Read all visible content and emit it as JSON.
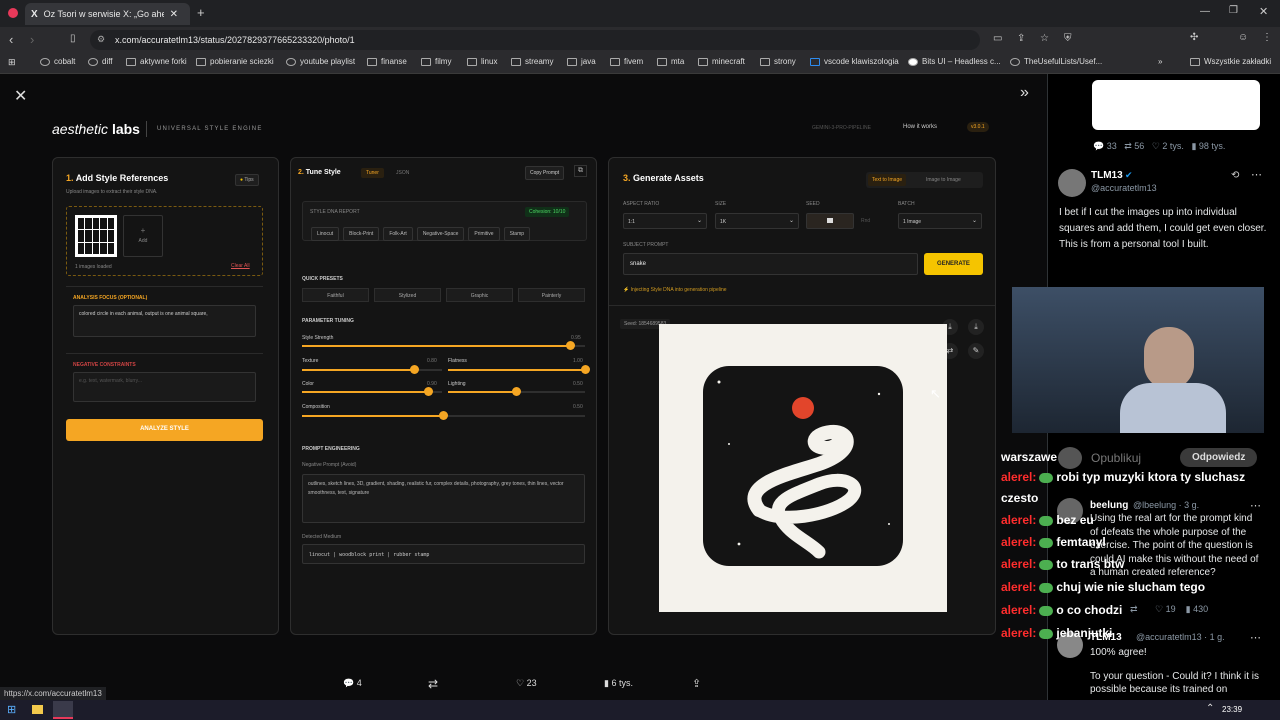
{
  "browser": {
    "tab_title": "Oz Tsori w serwisie X: „Go ahead…",
    "url": "x.com/accuratetlm13/status/2027829377665233320/photo/1",
    "bookmarks": [
      "cobalt",
      "diff",
      "aktywne forki",
      "pobieranie sciezki",
      "youtube playlist",
      "finanse",
      "filmy",
      "linux",
      "streamy",
      "java",
      "fivem",
      "mta",
      "minecraft",
      "strony",
      "vscode klawiszologia",
      "Bits UI – Headless c...",
      "TheUsefulLists/Usef..."
    ],
    "other_bookmarks": "Wszystkie zakładki",
    "status_url": "https://x.com/accuratetlm13"
  },
  "app": {
    "logo_italic": "aesthetic",
    "logo_bold": "labs",
    "subtitle": "UNIVERSAL STYLE ENGINE",
    "pipeline": "GEMINI-3-PRO-PIPELINE",
    "how_it_works": "How it works",
    "version": "v3.0.1",
    "panel1": {
      "step": "1.",
      "title": "Add Style References",
      "tips": "Tips",
      "desc": "Upload images to extract their style DNA.",
      "add": "Add",
      "loaded": "1 images loaded",
      "clear_all": "Clear All",
      "focus_label": "ANALYSIS FOCUS (OPTIONAL)",
      "focus_value": "colored circle in each animal, output is one animal square,",
      "neg_label": "NEGATIVE CONSTRAINTS",
      "neg_placeholder": "e.g. text, watermark, blurry...",
      "analyze_btn": "ANALYZE STYLE"
    },
    "panel2": {
      "step": "2.",
      "title": "Tune Style",
      "tab_tuner": "Tuner",
      "tab_json": "JSON",
      "copy_prompt": "Copy Prompt",
      "dna_label": "STYLE DNA REPORT",
      "cohesion": "Cohesion: 10/10",
      "tags": [
        "Linocut",
        "Block-Print",
        "Folk-Art",
        "Negative-Space",
        "Primitive",
        "Stamp"
      ],
      "presets_label": "QUICK PRESETS",
      "presets": [
        "Faithful",
        "Stylized",
        "Graphic",
        "Painterly"
      ],
      "tuning_label": "PARAMETER TUNING",
      "sliders": [
        {
          "label": "Style Strength",
          "value": "0.95",
          "level": 0.95
        },
        {
          "label": "Texture",
          "value": "0.80",
          "level": 0.8
        },
        {
          "label": "Flatness",
          "value": "1.00",
          "level": 1.0
        },
        {
          "label": "Color",
          "value": "0.90",
          "level": 0.9
        },
        {
          "label": "Lighting",
          "value": "0.50",
          "level": 0.5
        },
        {
          "label": "Composition",
          "value": "0.50",
          "level": 0.5
        }
      ],
      "prompt_eng_label": "PROMPT ENGINEERING",
      "neg_prompt_label": "Negative Prompt (Avoid)",
      "neg_prompt_value": "outlines, sketch lines, 3D, gradient, shading, realistic fur, complex details, photography, grey tones, thin lines, vector smoothness, text, signature",
      "medium_label": "Detected Medium",
      "medium_value": "linocut | woodblock print | rubber stamp"
    },
    "panel3": {
      "step": "3.",
      "title": "Generate Assets",
      "tab_t2i": "Text to Image",
      "tab_i2i": "Image to Image",
      "aspect_label": "ASPECT RATIO",
      "aspect_value": "1:1",
      "size_label": "SIZE",
      "size_value": "1K",
      "seed_label": "SEED",
      "seed_rnd": "Rnd",
      "batch_label": "BATCH",
      "batch_value": "1 Image",
      "subject_label": "SUBJECT PROMPT",
      "subject_value": "snake",
      "generate_btn": "GENERATE",
      "inject_note": "Injecting Style DNA into generation pipeline",
      "seed_badge": "Seed: 1854689583"
    }
  },
  "tweet_actions": {
    "replies": "4",
    "likes": "23",
    "views": "6 tys."
  },
  "feed": {
    "post_stats": {
      "replies": "33",
      "reposts": "56",
      "likes": "2 tys.",
      "views": "98 tys."
    },
    "reply1": {
      "name": "TLM13",
      "handle": "@accuratetlm13",
      "text": "I bet if I cut the images up into individual squares and add them, I could get even closer.  This is from a personal tool I built."
    },
    "repost_bar": {
      "name": "warszawe",
      "republish": "Opublikuj",
      "reply": "Odpowiedz"
    },
    "reply2": {
      "name": "beelung",
      "handle": "@lbeelung · 3 g.",
      "text": "Using the real art for the prompt kind of defeats the whole purpose of the exercise. The point of the question is could AI make this without the need of a human created reference?",
      "likes": "19",
      "views": "430"
    },
    "reply3": {
      "name": "TLM13",
      "handle": "@accuratetlm13 · 1 g.",
      "line1": "100% agree!",
      "line2": "To your question - Could it? I think it is possible because its trained on"
    }
  },
  "chat": [
    {
      "user": "alerel:",
      "msg": "robi typ muzyki ktora ty sluchasz"
    },
    {
      "user": "",
      "msg": "czesto"
    },
    {
      "user": "alerel:",
      "msg": "bez eu"
    },
    {
      "user": "alerel:",
      "msg": "femtanyl"
    },
    {
      "user": "alerel:",
      "msg": "to trans btw"
    },
    {
      "user": "alerel:",
      "msg": "chuj wie nie slucham tego"
    },
    {
      "user": "alerel:",
      "msg": "o co chodzi"
    },
    {
      "user": "alerel:",
      "msg": "jebanjutki"
    }
  ],
  "clock": "23:39"
}
